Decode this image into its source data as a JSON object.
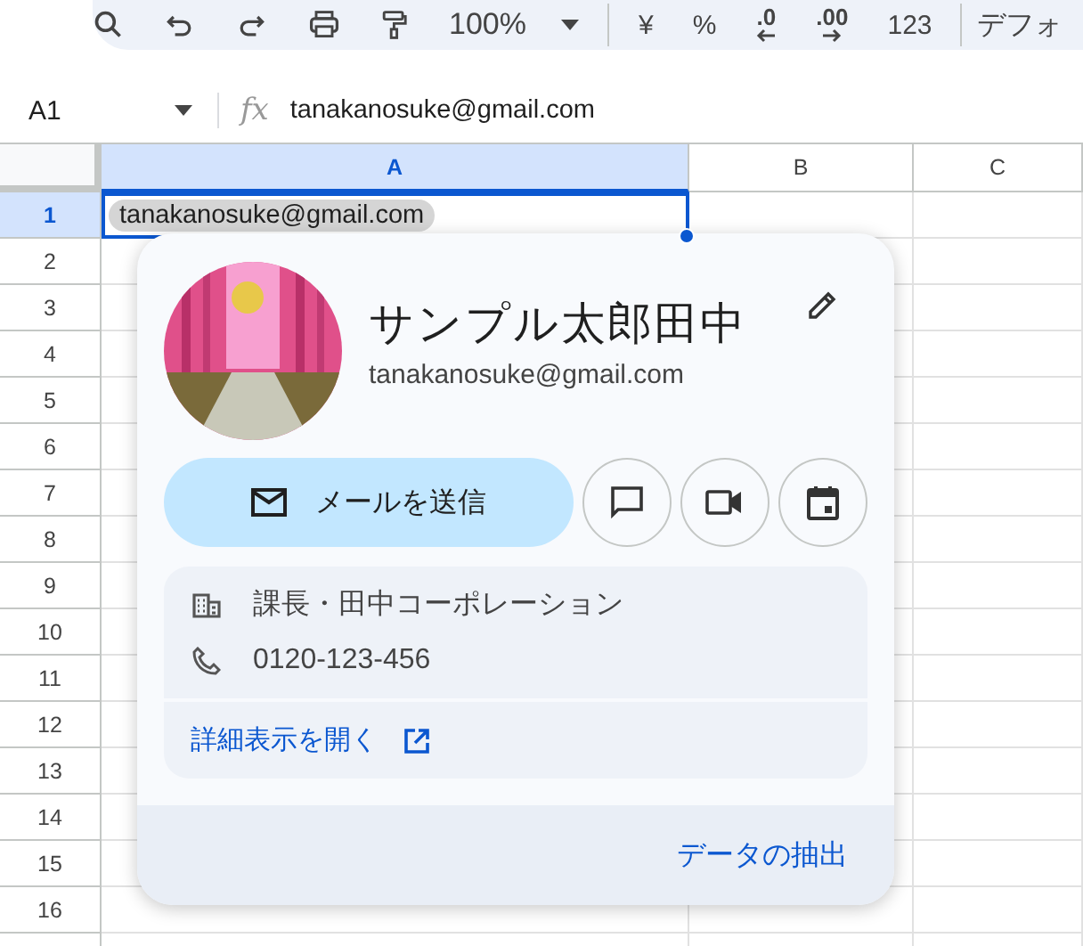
{
  "toolbar": {
    "items": [
      {
        "kind": "search"
      },
      {
        "kind": "undo"
      },
      {
        "kind": "redo"
      },
      {
        "kind": "print"
      },
      {
        "kind": "paint"
      },
      {
        "kind": "zoom",
        "label": "100%"
      },
      {
        "kind": "text",
        "label": "¥"
      },
      {
        "kind": "text",
        "label": "%"
      },
      {
        "kind": "decimal-less",
        "label": ".0"
      },
      {
        "kind": "decimal-more",
        "label": ".00"
      },
      {
        "kind": "text",
        "label": "123"
      },
      {
        "kind": "font",
        "label": "デフォ"
      }
    ]
  },
  "formula_bar": {
    "cell_ref": "A1",
    "fx": "fx",
    "formula": "tanakanosuke@gmail.com"
  },
  "columns": [
    {
      "label": "A",
      "selected": true
    },
    {
      "label": "B",
      "selected": false
    },
    {
      "label": "C",
      "selected": false
    }
  ],
  "rows": [
    {
      "label": "1",
      "selected": true,
      "cell": "tanakanosuke@gmail.com"
    },
    {
      "label": "2",
      "selected": false
    },
    {
      "label": "3",
      "selected": false
    },
    {
      "label": "4",
      "selected": false
    },
    {
      "label": "5",
      "selected": false
    },
    {
      "label": "6",
      "selected": false
    },
    {
      "label": "7",
      "selected": false
    },
    {
      "label": "8",
      "selected": false
    },
    {
      "label": "9",
      "selected": false
    },
    {
      "label": "10",
      "selected": false
    },
    {
      "label": "11",
      "selected": false
    },
    {
      "label": "12",
      "selected": false
    },
    {
      "label": "13",
      "selected": false
    },
    {
      "label": "14",
      "selected": false
    },
    {
      "label": "15",
      "selected": false
    },
    {
      "label": "16",
      "selected": false
    }
  ],
  "contact_card": {
    "name": "サンプル太郎田中",
    "email": "tanakanosuke@gmail.com",
    "send_mail": "メールを送信",
    "actions": [
      {
        "kind": "chat"
      },
      {
        "kind": "video"
      },
      {
        "kind": "calendar"
      }
    ],
    "details": [
      {
        "kind": "company",
        "text": "課長・田中コーポレーション"
      },
      {
        "kind": "phone",
        "text": "0120-123-456"
      }
    ],
    "open_details": "詳細表示を開く",
    "footer_link": "データの抽出"
  }
}
